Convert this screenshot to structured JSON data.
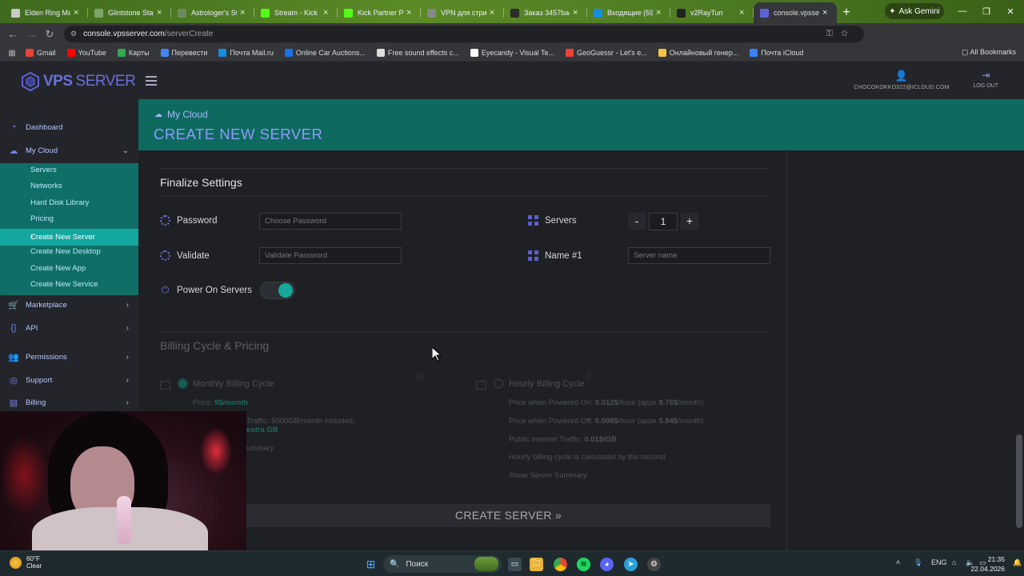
{
  "browser": {
    "tabs": [
      {
        "title": "Elden Ring Map",
        "icon": "map-icon",
        "color": "#c9c9c9"
      },
      {
        "title": "Glintstone Staff",
        "icon": "staff-icon",
        "color": "#7ea36b"
      },
      {
        "title": "Astrologer's Sta",
        "icon": "page-icon",
        "color": "#6e8b5f"
      },
      {
        "title": "Stream - Kick D",
        "icon": "kick-icon",
        "color": "#53fc18"
      },
      {
        "title": "Kick Partner Pro",
        "icon": "kick-icon",
        "color": "#53fc18"
      },
      {
        "title": "VPN для стрим",
        "icon": "vpn-icon",
        "color": "#888888"
      },
      {
        "title": "Заказ 3457bae8",
        "icon": "order-icon",
        "color": "#2b2b2b"
      },
      {
        "title": "Входящие (593",
        "icon": "mail-icon",
        "color": "#168de2"
      },
      {
        "title": "v2RayTun",
        "icon": "v2ray-icon",
        "color": "#222222"
      },
      {
        "title": "console.vpsserv",
        "icon": "vps-icon",
        "color": "#5d63d8",
        "active": true
      }
    ],
    "gemini_label": "Ask Gemini",
    "url_host": "console.vpsserver.com",
    "url_path": "/serverCreate",
    "bookmarks": [
      {
        "label": "Gmail",
        "color": "#ea4335"
      },
      {
        "label": "YouTube",
        "color": "#ff0000"
      },
      {
        "label": "Карты",
        "color": "#34a853"
      },
      {
        "label": "Перевести",
        "color": "#4285f4"
      },
      {
        "label": "Почта Mail.ru",
        "color": "#168de2"
      },
      {
        "label": "Online Car Auctions...",
        "color": "#1a73e8"
      },
      {
        "label": "Free sound effects c...",
        "color": "#dddddd"
      },
      {
        "label": "Eyecandy - Visual Te...",
        "color": "#ffffff"
      },
      {
        "label": "GeoGuessr - Let's e...",
        "color": "#ea4335"
      },
      {
        "label": "Онлайновый генер...",
        "color": "#f4c542"
      },
      {
        "label": "Почта iCloud",
        "color": "#3b82f6"
      }
    ],
    "all_bookmarks": "All Bookmarks"
  },
  "app": {
    "logo_vps": "VPS",
    "logo_server": "SERVER",
    "user_email": "CHOCOKOKKO322@ICLOUD.COM",
    "logout": "LOG OUT",
    "sidebar": {
      "dashboard": "Dashboard",
      "my_cloud": "My Cloud",
      "sub": [
        "Servers",
        "Networks",
        "Hard Disk Library",
        "Pricing",
        "Create New Server",
        "Create New Desktop",
        "Create New App",
        "Create New Service"
      ],
      "marketplace": "Marketplace",
      "api": "API",
      "permissions": "Permissions",
      "support": "Support",
      "billing": "Billing"
    },
    "breadcrumb": "My Cloud",
    "page_title": "CREATE NEW SERVER",
    "finalize": {
      "title": "Finalize Settings",
      "password_label": "Password",
      "password_placeholder": "Choose Password",
      "validate_label": "Validate",
      "validate_placeholder": "Validate Password",
      "power_label": "Power On Servers",
      "servers_label": "Servers",
      "servers_minus": "-",
      "servers_count": "1",
      "servers_plus": "+",
      "name_label": "Name #1",
      "name_placeholder": "Server name"
    },
    "billing": {
      "title": "Billing Cycle & Pricing",
      "monthly_label": "Monthly Billing Cycle",
      "monthly_price_prefix": "Price:",
      "monthly_price": "9$/month",
      "monthly_traffic": "Traffic: 5000GB/month included,",
      "monthly_extra": "extra GB",
      "monthly_summary": "ummary",
      "hourly_label": "Hourly Billing Cycle",
      "powered_on_prefix": "Price when Powered On:",
      "powered_on_rate": "0.012$",
      "powered_on_mid": "/hour (appx",
      "powered_on_month": "8.76$",
      "powered_on_suffix": "/month)",
      "powered_off_prefix": "Price when Powered Off:",
      "powered_off_rate": "0.008$",
      "powered_off_mid": "/hour (appx",
      "powered_off_month": "5.84$",
      "powered_off_suffix": "/month)",
      "public_traffic_prefix": "Public Internet Traffic:",
      "public_traffic_value": "0.01$/GB",
      "hourly_note": "Hourly billing cycle is calculated by the second",
      "show_summary": "Show Server Summary"
    },
    "create_button": "CREATE SERVER »"
  },
  "taskbar": {
    "temp": "60°F",
    "weather": "Clear",
    "search_placeholder": "Поиск",
    "lang": "ENG",
    "time": "21:35",
    "date": "22.04.2026"
  }
}
